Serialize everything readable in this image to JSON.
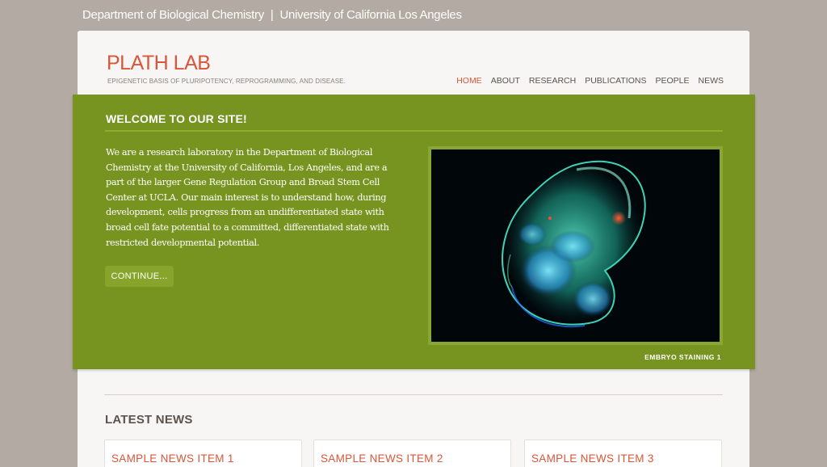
{
  "topbar": {
    "department": "Department of Biological Chemistry",
    "separator": "|",
    "university": "University of California Los Angeles"
  },
  "header": {
    "logo": "PLATH LAB",
    "tagline": "EPIGENETIC BASIS OF PLURIPOTENCY, REPROGRAMMING, AND DISEASE."
  },
  "nav": {
    "items": [
      {
        "label": "HOME",
        "active": true
      },
      {
        "label": "ABOUT"
      },
      {
        "label": "RESEARCH"
      },
      {
        "label": "PUBLICATIONS"
      },
      {
        "label": "PEOPLE"
      },
      {
        "label": "NEWS"
      }
    ]
  },
  "hero": {
    "title": "WELCOME TO OUR SITE!",
    "text": "We are a research laboratory in the Department of Biological Chemistry at the University of California, Los Angeles, and are a part of the larger Gene Regulation Group and Broad Stem Cell Center at UCLA. Our main interest is to understand how, during development, cells progress from an undifferentiated state with broad cell fate potential to a committed, differentiated state with restricted developmental potential.",
    "button": "CONTINUE...",
    "image_caption": "EMBRYO STAINING 1"
  },
  "latest_news": {
    "title": "LATEST NEWS",
    "items": [
      "SAMPLE NEWS ITEM 1",
      "SAMPLE NEWS ITEM 2",
      "SAMPLE NEWS ITEM 3"
    ]
  },
  "colors": {
    "background": "#b3aaa3",
    "accent": "#d9563a",
    "hero_green": "#76941f"
  }
}
